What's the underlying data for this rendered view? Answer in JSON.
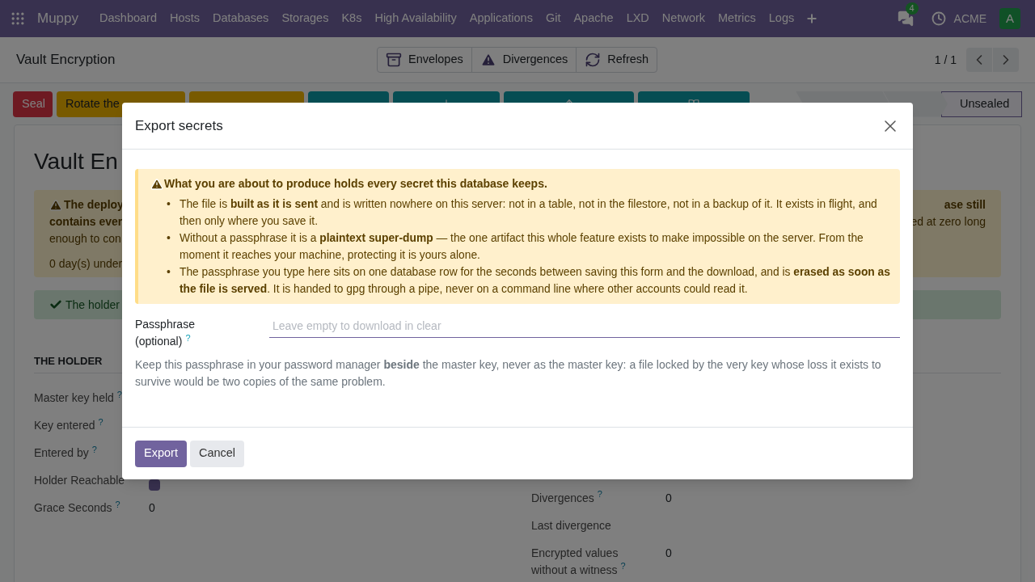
{
  "navbar": {
    "app_name": "Muppy",
    "menu": [
      "Dashboard",
      "Hosts",
      "Databases",
      "Storages",
      "K8s",
      "High Availability",
      "Applications",
      "Git",
      "Apache",
      "LXD",
      "Network",
      "Metrics",
      "Logs"
    ],
    "messages_badge": "4",
    "company": "ACME",
    "avatar": "A"
  },
  "control_panel": {
    "breadcrumb": "Vault Encryption",
    "actions": [
      {
        "kind": "archive",
        "label": "Envelopes"
      },
      {
        "kind": "warning",
        "label": "Divergences"
      },
      {
        "kind": "refresh",
        "label": "Refresh"
      }
    ],
    "pager": "1 / 1"
  },
  "status_bar": {
    "buttons": [
      {
        "kind": "danger",
        "label": "Seal"
      },
      {
        "kind": "warning",
        "label": "Rotate the"
      },
      {
        "kind": "warning"
      },
      {
        "kind": "info"
      },
      {
        "kind": "info"
      },
      {
        "kind": "info"
      },
      {
        "kind": "info"
      }
    ],
    "stages": [
      {
        "selected": false
      },
      {
        "selected": false
      },
      {
        "label": "Unsealed",
        "selected": true
      }
    ]
  },
  "sheet": {
    "title": "Vault En",
    "warning": {
      "left_lines": [
        "The deploy",
        "contains ever",
        "enough to con",
        "0 day(s) under"
      ],
      "right_lines": [
        "ase still",
        "ed at zero long"
      ]
    },
    "success": "The holder",
    "holder": {
      "heading": "THE HOLDER",
      "fields": [
        {
          "label": "Master key held",
          "help": "?"
        },
        {
          "label": "Key entered",
          "help": "?"
        },
        {
          "label": "Entered by",
          "help": "?"
        },
        {
          "label": "Holder Reachable",
          "kind": "checkbox",
          "checked": true
        },
        {
          "label": "Grace Seconds",
          "help": "?",
          "value": "0"
        }
      ]
    },
    "right_fields": [
      {
        "label": "Divergences",
        "help": "?",
        "value": "0"
      },
      {
        "label": "Last divergence"
      },
      {
        "label": "Encrypted values without a witness",
        "help": "?",
        "value": "0"
      }
    ]
  },
  "dialog": {
    "title": "Export secrets",
    "alert": {
      "heading": "What you are about to produce holds every secret this database keeps.",
      "items": [
        {
          "bullet": "•",
          "text": "The file is **built as it is sent** and is written nowhere on this server: not in a table, not in the filestore, not in a backup of it. It exists in flight, and then only where you save it."
        },
        {
          "bullet": "•",
          "text": "Without a passphrase it is a **plaintext super-dump** — the one artifact this whole feature exists to make impossible on the server. From the moment it reaches your machine, protecting it is yours alone."
        },
        {
          "bullet": "•",
          "text": "The passphrase you type here sits on one database row for the seconds between saving this form and the download, and is **erased as soon as the file is served**. It is handed to gpg through a pipe, never on a command line where other accounts could read it."
        }
      ]
    },
    "field": {
      "label": "Passphrase (optional)",
      "help": "?",
      "placeholder": "Leave empty to download in clear"
    },
    "hint": "Keep this passphrase in your password manager **beside** the master key, never as the master key: a file locked by the very key whose loss it exists to survive would be two copies of the same problem.",
    "buttons": [
      {
        "label": "Export",
        "kind": "primary"
      },
      {
        "label": "Cancel",
        "kind": "secondary"
      }
    ]
  }
}
